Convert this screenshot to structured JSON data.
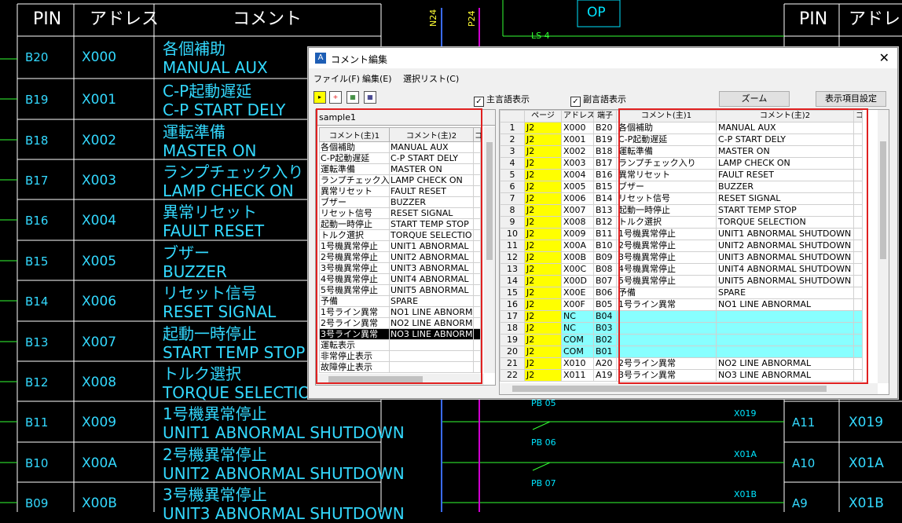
{
  "cad": {
    "left_headers": {
      "pin": "PIN",
      "address": "アドレス",
      "comment": "コメント"
    },
    "right_headers": {
      "pin": "PIN",
      "address": "アドレ"
    },
    "top_labels": {
      "n24": "N24",
      "p24": "P24",
      "op": "OP",
      "ls4": "LS 4"
    },
    "rows": [
      {
        "pin": "B20",
        "addr": "X000",
        "jp": "各個補助",
        "en": "MANUAL AUX"
      },
      {
        "pin": "B19",
        "addr": "X001",
        "jp": "C-P起動遅延",
        "en": "C-P START DELY"
      },
      {
        "pin": "B18",
        "addr": "X002",
        "jp": "運転準備",
        "en": "MASTER ON"
      },
      {
        "pin": "B17",
        "addr": "X003",
        "jp": "ランプチェック入り",
        "en": "LAMP CHECK ON"
      },
      {
        "pin": "B16",
        "addr": "X004",
        "jp": "異常リセット",
        "en": "FAULT RESET"
      },
      {
        "pin": "B15",
        "addr": "X005",
        "jp": "ブザー",
        "en": "BUZZER"
      },
      {
        "pin": "B14",
        "addr": "X006",
        "jp": "リセット信号",
        "en": "RESET SIGNAL"
      },
      {
        "pin": "B13",
        "addr": "X007",
        "jp": "起動一時停止",
        "en": "START TEMP STOP"
      },
      {
        "pin": "B12",
        "addr": "X008",
        "jp": "トルク選択",
        "en": "TORQUE SELECTIO"
      },
      {
        "pin": "B11",
        "addr": "X009",
        "jp": "1号機異常停止",
        "en": "UNIT1 ABNORMAL SHUTDOWN"
      },
      {
        "pin": "B10",
        "addr": "X00A",
        "jp": "2号機異常停止",
        "en": "UNIT2 ABNORMAL SHUTDOWN"
      },
      {
        "pin": "B09",
        "addr": "X00B",
        "jp": "3号機異常停止",
        "en": "UNIT3 ABNORMAL SHUTDOWN"
      }
    ],
    "right_rows": [
      {
        "pin": "A11",
        "addr": "X019"
      },
      {
        "pin": "A10",
        "addr": "X01A"
      },
      {
        "pin": "A9",
        "addr": "X01B"
      }
    ],
    "circuit_labels": {
      "pb05": "PB 05",
      "pb06": "PB 06",
      "pb07": "PB 07",
      "x019": "X019",
      "x01a": "X01A",
      "x01b": "X01B"
    }
  },
  "dialog": {
    "title": "コメント編集",
    "close": "✕",
    "menu": [
      "ファイル(F)",
      "編集(E)",
      "選択リスト(C)"
    ],
    "toolbar": {
      "main_lang_label": "主言語表示",
      "sub_lang_label": "副言語表示",
      "main_checked": "✓",
      "sub_checked": "✓",
      "zoom_button": "ズーム",
      "display_settings_button": "表示項目設定"
    },
    "left_panel": {
      "list_name": "sample1",
      "headers": [
        "コメント(主)1",
        "コメント(主)2",
        "コ"
      ],
      "rows": [
        [
          "各個補助",
          "MANUAL AUX"
        ],
        [
          "C-P起動遅延",
          "C-P START DELY"
        ],
        [
          "運転準備",
          "MASTER ON"
        ],
        [
          "ランプチェック入り",
          "LAMP CHECK ON"
        ],
        [
          "異常リセット",
          "FAULT RESET"
        ],
        [
          "ブザー",
          "BUZZER"
        ],
        [
          "リセット信号",
          "RESET SIGNAL"
        ],
        [
          "起動一時停止",
          "START TEMP STOP"
        ],
        [
          "トルク選択",
          "TORQUE SELECTIO"
        ],
        [
          "1号機異常停止",
          "UNIT1 ABNORMAL"
        ],
        [
          "2号機異常停止",
          "UNIT2 ABNORMAL"
        ],
        [
          "3号機異常停止",
          "UNIT3 ABNORMAL"
        ],
        [
          "4号機異常停止",
          "UNIT4 ABNORMAL"
        ],
        [
          "5号機異常停止",
          "UNIT5 ABNORMAL"
        ],
        [
          "予備",
          "SPARE"
        ],
        [
          "1号ライン異常",
          "NO1 LINE ABNORM"
        ],
        [
          "2号ライン異常",
          "NO2 LINE ABNORM"
        ],
        [
          "3号ライン異常",
          "NO3 LINE ABNORM"
        ],
        [
          "運転表示",
          ""
        ],
        [
          "非常停止表示",
          ""
        ],
        [
          "故障停止表示",
          ""
        ]
      ],
      "selected_index": 17
    },
    "right_panel": {
      "headers": [
        "",
        "ページ",
        "アドレス",
        "端子",
        "コメント(主)1",
        "コメント(主)2",
        "コ"
      ],
      "rows": [
        [
          "1",
          "J2",
          "X000",
          "B20",
          "各個補助",
          "MANUAL AUX"
        ],
        [
          "2",
          "J2",
          "X001",
          "B19",
          "C-P起動遅延",
          "C-P START DELY"
        ],
        [
          "3",
          "J2",
          "X002",
          "B18",
          "運転準備",
          "MASTER ON"
        ],
        [
          "4",
          "J2",
          "X003",
          "B17",
          "ランプチェック入り",
          "LAMP CHECK ON"
        ],
        [
          "5",
          "J2",
          "X004",
          "B16",
          "異常リセット",
          "FAULT RESET"
        ],
        [
          "6",
          "J2",
          "X005",
          "B15",
          "ブザー",
          "BUZZER"
        ],
        [
          "7",
          "J2",
          "X006",
          "B14",
          "リセット信号",
          "RESET SIGNAL"
        ],
        [
          "8",
          "J2",
          "X007",
          "B13",
          "起動一時停止",
          "START TEMP STOP"
        ],
        [
          "9",
          "J2",
          "X008",
          "B12",
          "トルク選択",
          "TORQUE SELECTION"
        ],
        [
          "10",
          "J2",
          "X009",
          "B11",
          "1号機異常停止",
          "UNIT1 ABNORMAL SHUTDOWN"
        ],
        [
          "11",
          "J2",
          "X00A",
          "B10",
          "2号機異常停止",
          "UNIT2 ABNORMAL SHUTDOWN"
        ],
        [
          "12",
          "J2",
          "X00B",
          "B09",
          "3号機異常停止",
          "UNIT3 ABNORMAL SHUTDOWN"
        ],
        [
          "13",
          "J2",
          "X00C",
          "B08",
          "4号機異常停止",
          "UNIT4 ABNORMAL SHUTDOWN"
        ],
        [
          "14",
          "J2",
          "X00D",
          "B07",
          "5号機異常停止",
          "UNIT5 ABNORMAL SHUTDOWN"
        ],
        [
          "15",
          "J2",
          "X00E",
          "B06",
          "予備",
          "SPARE"
        ],
        [
          "16",
          "J2",
          "X00F",
          "B05",
          "1号ライン異常",
          "NO1 LINE ABNORMAL"
        ],
        [
          "17",
          "J2",
          "NC",
          "B04",
          "",
          ""
        ],
        [
          "18",
          "J2",
          "NC",
          "B03",
          "",
          ""
        ],
        [
          "19",
          "J2",
          "COM",
          "B02",
          "",
          ""
        ],
        [
          "20",
          "J2",
          "COM",
          "B01",
          "",
          ""
        ],
        [
          "21",
          "J2",
          "X010",
          "A20",
          "2号ライン異常",
          "NO2 LINE ABNORMAL"
        ],
        [
          "22",
          "J2",
          "X011",
          "A19",
          "3号ライン異常",
          "NO3 LINE ABNORMAL"
        ]
      ],
      "highlight_rows": [
        16,
        17,
        18,
        19
      ],
      "selected_row": 21
    },
    "colors": {
      "page_cell": "#ffff00",
      "nc_row": "#88ffff",
      "annotation": "#e02020"
    }
  }
}
